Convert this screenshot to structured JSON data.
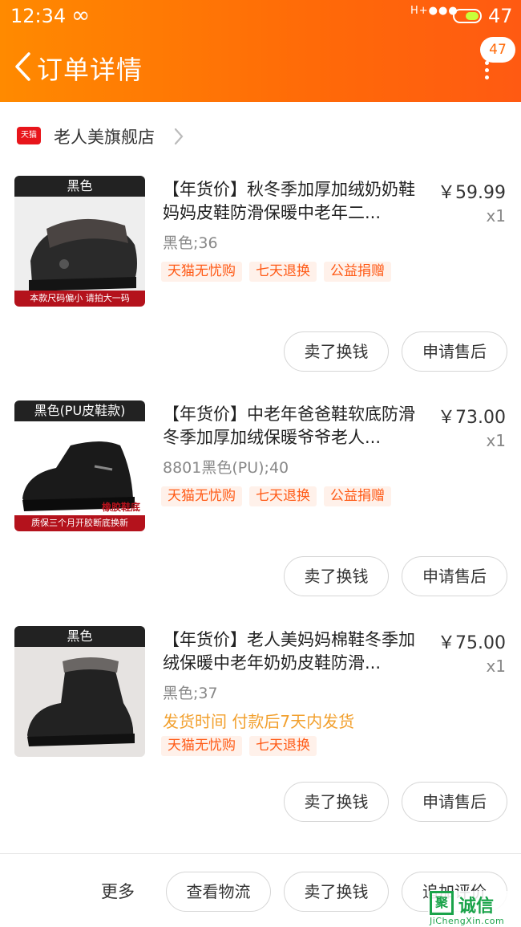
{
  "colors": {
    "accent": "#ff6a08",
    "tag_bg": "#fff1ea",
    "tag_text": "#ff5a16",
    "ship_text": "#f2a02e",
    "tmall_red": "#e8151b"
  },
  "status_bar": {
    "time": "12:34",
    "sync_symbol": "∞",
    "signal_label": "H+●●●",
    "battery_level": "47"
  },
  "header": {
    "title": "订单详情",
    "back_icon": "chevron-left-icon",
    "message_badge": "47",
    "more_icon": "vertical-dots-icon"
  },
  "shop": {
    "logo_text": "天猫",
    "name": "老人美旗舰店",
    "chevron_icon": "chevron-right-icon"
  },
  "items": [
    {
      "thumb_top": "黑色",
      "thumb_bottom": "本款尺码偏小  请拍大一码",
      "title": "【年货价】秋冬季加厚加绒奶奶鞋妈妈皮鞋防滑保暖中老年二...",
      "price": "￥59.99",
      "qty": "x1",
      "sku": "黑色;36",
      "shipping": "",
      "tags": [
        "天猫无忧购",
        "七天退换",
        "公益捐赠"
      ],
      "actions": [
        "卖了换钱",
        "申请售后"
      ]
    },
    {
      "thumb_top": "黑色(PU皮鞋款)",
      "thumb_side": "橡胶鞋底",
      "thumb_bottom": "质保三个月开胶断底换新",
      "title": "【年货价】中老年爸爸鞋软底防滑冬季加厚加绒保暖爷爷老人...",
      "price": "￥73.00",
      "qty": "x1",
      "sku": "8801黑色(PU);40",
      "shipping": "",
      "tags": [
        "天猫无忧购",
        "七天退换",
        "公益捐赠"
      ],
      "actions": [
        "卖了换钱",
        "申请售后"
      ]
    },
    {
      "thumb_top": "黑色",
      "title": "【年货价】老人美妈妈棉鞋冬季加绒保暖中老年奶奶皮鞋防滑...",
      "price": "￥75.00",
      "qty": "x1",
      "sku": "黑色;37",
      "shipping": "发货时间 付款后7天内发货",
      "tags": [
        "天猫无忧购",
        "七天退换"
      ],
      "actions": [
        "卖了换钱",
        "申请售后"
      ]
    }
  ],
  "bottom_bar": {
    "more": "更多",
    "buttons": [
      "查看物流",
      "卖了换钱",
      "追加评价"
    ]
  },
  "watermark": {
    "logo_char": "聚",
    "text": "诚信",
    "domain": "JiChengXin.com"
  }
}
